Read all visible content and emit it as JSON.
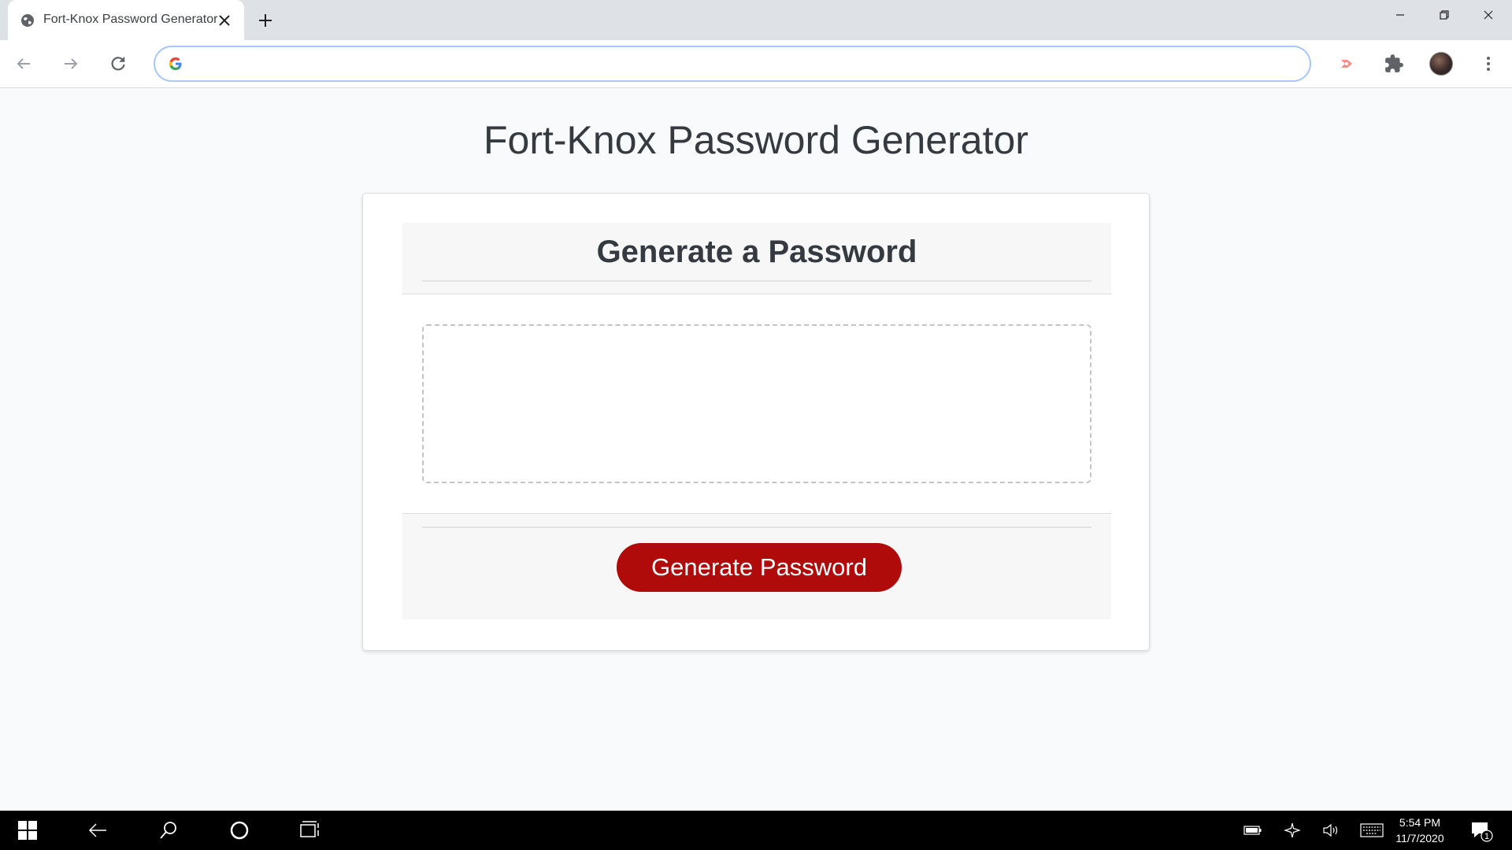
{
  "browser": {
    "tab_title": "Fort-Knox Password Generator",
    "address_value": "",
    "address_placeholder": ""
  },
  "page": {
    "title": "Fort-Knox Password Generator",
    "card_header": "Generate a Password",
    "password_value": "",
    "password_placeholder": "",
    "generate_label": "Generate Password",
    "accent_color": "#b00b0b"
  },
  "taskbar": {
    "time": "5:54 PM",
    "date": "11/7/2020",
    "notification_count": "1"
  }
}
